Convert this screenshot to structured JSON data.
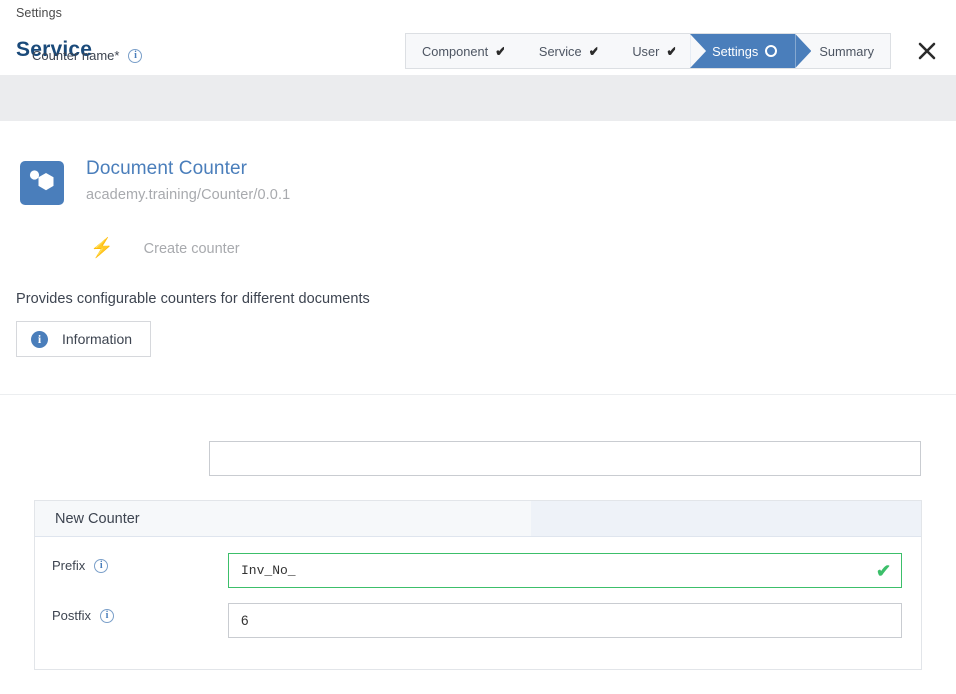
{
  "header": {
    "breadcrumb": "Settings",
    "title": "Service",
    "close_icon": "close-icon",
    "wizard": {
      "steps": [
        {
          "label": "Component",
          "state": "done",
          "marker": "check"
        },
        {
          "label": "Service",
          "state": "done",
          "marker": "check"
        },
        {
          "label": "User",
          "state": "done",
          "marker": "check"
        },
        {
          "label": "Settings",
          "state": "active",
          "marker": "circle"
        },
        {
          "label": "Summary",
          "state": "upcoming",
          "marker": "none"
        }
      ]
    }
  },
  "service": {
    "icon": "hexagon-node-icon",
    "name": "Document Counter",
    "identifier": "academy.training/Counter/0.0.1",
    "action": {
      "icon": "lightning-bolt-icon",
      "label": "Create counter"
    },
    "description": "Provides configurable counters for different documents",
    "information_button": {
      "icon": "info-filled-icon",
      "label": "Information"
    }
  },
  "form": {
    "counter_name": {
      "label": "Counter name*",
      "info_icon": "info-outline-icon",
      "value": "",
      "placeholder": ""
    },
    "panel": {
      "title": "New Counter",
      "fields": [
        {
          "label": "Prefix",
          "info_icon": "info-outline-icon",
          "value": "Inv_No_",
          "placeholder": "",
          "valid": true,
          "valid_icon": "check-icon"
        },
        {
          "label": "Postfix",
          "info_icon": "info-outline-icon",
          "value": "6",
          "placeholder": "",
          "valid": false
        }
      ]
    }
  },
  "colors": {
    "accent_blue": "#4a7ebb",
    "title_blue": "#1a4a7a",
    "success_green": "#3cbf6a",
    "band_gray": "#ebecee",
    "muted_gray": "#a8aaae"
  }
}
